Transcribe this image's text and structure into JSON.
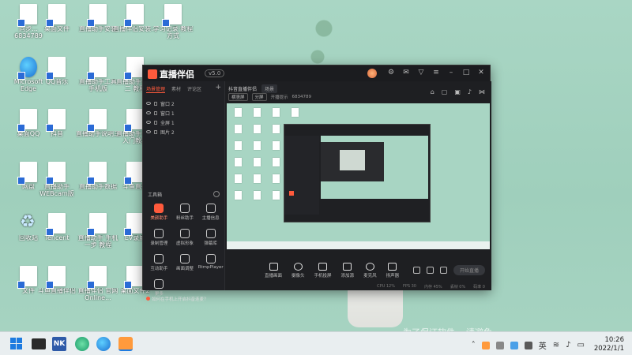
{
  "wallpaper": {
    "overlay_text": "为了保证软件... 请避免..."
  },
  "desktop_icons": [
    {
      "label": "同步... 6834789"
    },
    {
      "label": "桌面文件"
    },
    {
      "label": "直播助手安装"
    },
    {
      "label": "直播伴侣安装..."
    },
    {
      "label": "学习记录·教程方式"
    },
    {
      "label": "Microsoft Edge"
    },
    {
      "label": "QQ音乐"
    },
    {
      "label": "直播助手工具 手机版"
    },
    {
      "label": "直播助手设置 二 教程"
    },
    {
      "label": "桌面QQ"
    },
    {
      "label": "抖音"
    },
    {
      "label": "直播助手说明三"
    },
    {
      "label": "直播助手设置 入门教程"
    },
    {
      "label": "网盘"
    },
    {
      "label": "直播助手 WEBcam版"
    },
    {
      "label": "直播助手数据"
    },
    {
      "label": "斗鱼直播"
    },
    {
      "label": "回收站"
    },
    {
      "label": "Tencent"
    },
    {
      "label": "直播助手 手机 一步 教程"
    },
    {
      "label": "EV录屏"
    },
    {
      "label": "文件"
    },
    {
      "label": "斗鱼直播伴侣"
    },
    {
      "label": "直播伴侣 官网Online..."
    },
    {
      "label": "桌面文件2"
    }
  ],
  "app": {
    "title": "直播伴侣",
    "version_badge": "v5.0",
    "left_tabs": [
      "场景管理",
      "素材",
      "评论区"
    ],
    "layers": [
      "窗口 2",
      "窗口 1",
      "全屏 1",
      "图片 2"
    ],
    "tools_title": "工具箱",
    "tools": [
      "美颜助手",
      "粉丝助手",
      "主播信息",
      "录制管理",
      "虚拟形象",
      "弹幕库",
      "互动助手",
      "画面调整",
      "RtmpPlayer",
      "更多"
    ],
    "notice": "如何在手机上开启抖音连麦？",
    "scene_name": "抖音直播伴侣",
    "scene_btn": "场景",
    "info_items": [
      "横竖屏",
      "分屏",
      "开播提示",
      "6834789"
    ],
    "bottom_controls": [
      "直播画面",
      "摄像头",
      "手机投屏",
      "添加源",
      "麦克风",
      "扬声器"
    ],
    "live_button": "开始直播",
    "status_items": [
      "CPU 12%",
      "FPS 30",
      "内存 45%",
      "丢帧 0%",
      "码率 0"
    ]
  },
  "taskbar": {
    "nk_label": "NK",
    "ime": "英",
    "time": "10:26",
    "date": "2022/1/1"
  },
  "colors": {
    "accent": "#ff5a3c",
    "window_bg": "#1f2023",
    "wallpaper": "#a9d6c4"
  }
}
